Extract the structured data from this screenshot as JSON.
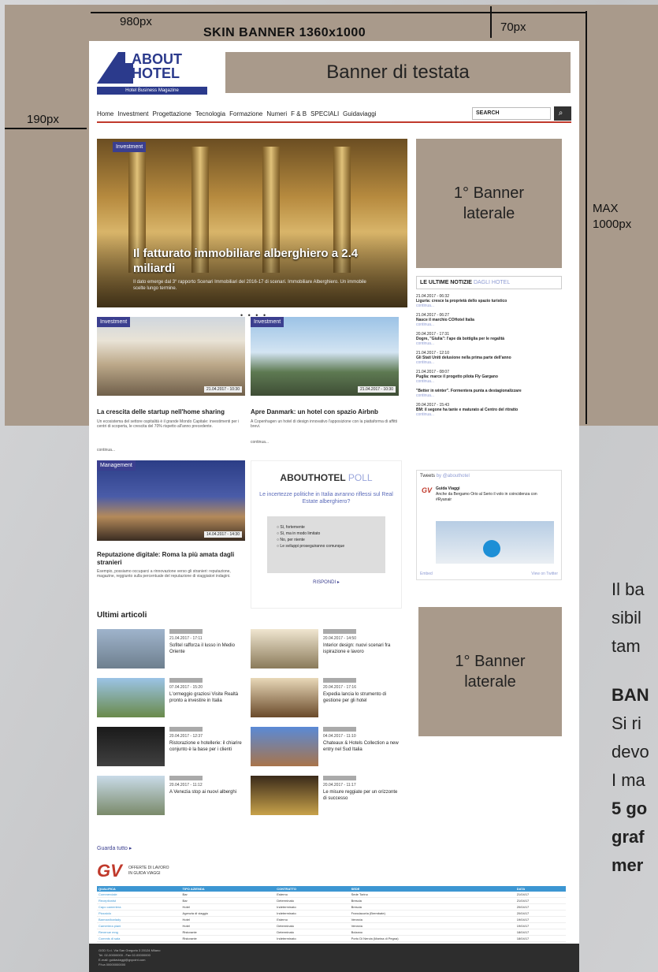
{
  "annotations": {
    "width_total": "980px",
    "skin_title": "SKIN BANNER  1360x1000",
    "top_offset": "70px",
    "left_offset": "190px",
    "max_height": "MAX\n1000px"
  },
  "header": {
    "logo_line1": "ABOUT",
    "logo_line2": "HOTEL",
    "logo_tagline": "Hotel Business Magazine",
    "banner_top": "Banner di testata"
  },
  "nav": {
    "items": [
      "Home",
      "Investment",
      "Progettazione",
      "Tecnologia",
      "Formazione",
      "Numeri",
      "F & B",
      "SPECIALI",
      "Guidaviaggi"
    ],
    "search_placeholder": "SEARCH"
  },
  "hero": {
    "tag": "Investment",
    "title": "Il fatturato immobiliare alberghiero a 2.4 miliardi",
    "subtitle": "Il dato emerge dal 3° rapporto Scenari Immobiliari del 2016-17 di scenari. Immobiliare Alberghiero. Un immobile scelte lungo termine.",
    "dots": "• • • •"
  },
  "side": {
    "banner1": "1° Banner\nlaterale",
    "banner2": "1° Banner\nlaterale",
    "news_title": "LE ULTIME NOTIZIE",
    "news_title_accent": "DAGLI HOTEL",
    "news": [
      {
        "date": "21.04.2017 - 06:32",
        "text": "Liguria: cresce la proprietà dello spazio turistico",
        "more": "continua..."
      },
      {
        "date": "21.04.2017 - 06:27",
        "text": "Nasce il marchio COHotel Italia",
        "more": "continua..."
      },
      {
        "date": "20.04.2017 - 17:31",
        "text": "Dogre, \"Giulia\": l'ape dà bottiglia per le regalità",
        "more": "continua..."
      },
      {
        "date": "21.04.2017 - 12:10",
        "text": "Gli Stati Uniti delusione nella prima parte dell'anno",
        "more": "continua..."
      },
      {
        "date": "21.04.2017 - 08:07",
        "text": "Puglia: marce il progetto pilota Fly Gargano",
        "more": "continua..."
      },
      {
        "date": "",
        "text": "\"Better in winter\". Formentera punta a destagionalizzare",
        "more": "continua..."
      },
      {
        "date": "20.04.2017 - 15:43",
        "text": "BM: il segone ha tante e maturato al Centro del ritratto",
        "more": "continua..."
      }
    ],
    "twitter_title": "Tweets",
    "twitter_by": "by @abouthotel",
    "tweet_user": "Guida Viaggi",
    "tweet_text": "Anche da Bergamo Orio al Serio il volo in coincidenza con #Ryanair",
    "tweet_embed": "Embed",
    "tweet_view": "View on Twitter"
  },
  "articles": [
    {
      "tag": "Investment",
      "date": "21.04.2017 - 10:30",
      "title": "La crescita delle startup nell'home sharing",
      "text": "Un ecosistema del settore ospitalità è il grande Mondo Capitale: investimenti per i centri di scoperta, le crescita del 70% rispetto all'anno precedente.",
      "more": "continua..."
    },
    {
      "tag": "Investment",
      "date": "21.04.2017 - 10:30",
      "title": "Apre Danmark: un hotel con spazio Airbnb",
      "text": "A Copenhagen un hotel di design innovativo l'apposizione con la piattaforma di affitti brevi.",
      "more": "continua..."
    },
    {
      "tag": "Management",
      "date": "14.04.2017 - 14:30",
      "title": "Reputazione digitale: Roma la più amata dagli stranieri",
      "text": "Esempio, possiamo occuparci a rinnovazione verso gli stranieri: reputazione, magazine, reggiunto sulla percentuale del reputazione di viaggiatori indagini.",
      "more": ""
    }
  ],
  "poll": {
    "title": "ABOUTHOTEL",
    "title_accent": "POLL",
    "question": "Le incertezze politiche in Italia avranno riflessi sul Real Estate alberghiero?",
    "options": [
      "Sì, fortemente",
      "Sì, ma in modo limitato",
      "No, per niente",
      "Le sviluppi proseguiranno comunque"
    ],
    "button": "RISPONDI ▸"
  },
  "latest": {
    "title": "Ultimi articoli",
    "items": [
      {
        "date": "21.04.2017 - 17:11",
        "title": "Sofitel rafforza il lusso in Medio Oriente"
      },
      {
        "date": "20.04.2017 - 14:50",
        "title": "Interior design: nuovi scenari fra ispirazione e lavoro"
      },
      {
        "date": "07.04.2017 - 15:20",
        "title": "L'ormeggio graziosi Visite Realtà pronto a investire in Italia"
      },
      {
        "date": "20.04.2017 - 17:16",
        "title": "Expedia lancia lo strumento di gestione per gli hotel"
      },
      {
        "date": "20.04.2017 - 12:37",
        "title": "Ristorazione e hotellerie: il chiarire conjunto è la base per i clienti"
      },
      {
        "date": "04.04.2017 - 11:10",
        "title": "Chateaux & Hotels Collection a new entry nel Sud Italia"
      },
      {
        "date": "20.04.2017 - 11:12",
        "title": "A Venezia stop ai nuovi alberghi"
      },
      {
        "date": "20.04.2017 - 11:17",
        "title": "Le misure reggiate per un orizzonte di successo"
      }
    ],
    "more": "Guarda tutto ▸"
  },
  "jobs": {
    "logo": "GV",
    "label": "OFFERTE DI LAVORO\nIN GUIDA VIAGGI",
    "headers": [
      "QUALIFICA",
      "TIPO AZIENDA",
      "CONTRATTO",
      "SEDE",
      "DATA"
    ],
    "rows": [
      [
        "Commerciale",
        "Bar",
        "Esterno",
        "Sede Torino",
        "21/04/17"
      ],
      [
        "Receptionist",
        "Bar",
        "Determinato",
        "Brescia",
        "21/04/17"
      ],
      [
        "Capo cameriera",
        "Hotel",
        "Indeterminato",
        "Brescia",
        "20/04/17"
      ],
      [
        "Pizzaiolo",
        "Agenzia di viaggio",
        "Indeterminato",
        "Franciacorta (Brembate)",
        "20/04/17"
      ],
      [
        "Barman/barlady",
        "Hotel",
        "Esterno",
        "Venezia",
        "19/04/17"
      ],
      [
        "Cameriera piani",
        "Hotel",
        "Determinato",
        "Venezia",
        "19/04/17"
      ],
      [
        "Revenue mng",
        "Ristorante",
        "Determinato",
        "Bolzano",
        "18/04/17"
      ],
      [
        "Commis di sala",
        "Ristorante",
        "Indeterminato",
        "Porto Di Nervia (Marina di Pegna)",
        "18/04/17"
      ]
    ]
  },
  "footer": {
    "lines": [
      "GOD S.r.l. Via San Gregorio 3 20124 Milano",
      "Tel. 02-00000000 - Fax 02-00000000",
      "E-mail: guidaviaggi@gvpoint.com",
      "P.Iva 00000000000"
    ]
  },
  "right_text": {
    "line1": "Il ba",
    "line2": "sibil",
    "line3": "tam",
    "bold1": "BAN",
    "line4": "Si ri",
    "line5": "devo",
    "line6": "I ma",
    "bold2": "5 go",
    "bold3": "graf",
    "bold4": "mer"
  },
  "colors": {
    "skin": "#a99a8b",
    "accent_red": "#c0392b",
    "brand_blue": "#2b3a8c"
  }
}
